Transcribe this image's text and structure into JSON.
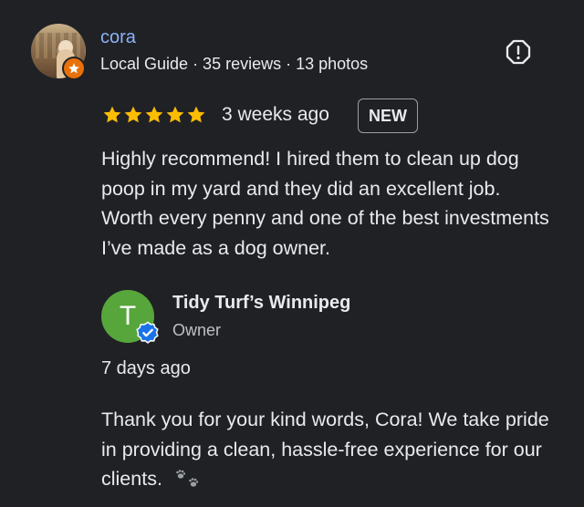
{
  "reviewer": {
    "name": "cora",
    "meta": "Local Guide · 35 reviews · 13 photos"
  },
  "review": {
    "rating": 5,
    "time": "3 weeks ago",
    "badge": "NEW",
    "text": "Highly recommend! I hired them to clean up dog poop in my yard and they did an excellent job. Worth every penny and one of the best investments I’ve made as a dog owner."
  },
  "owner": {
    "initial": "T",
    "name": "Tidy Turf’s Winnipeg",
    "role": "Owner",
    "time": "7 days ago",
    "reply": "Thank you for your kind words, Cora! We take pride in providing a clean, hassle-free experience for our clients."
  },
  "icons": {
    "star_color": "#fbbc04",
    "owner_avatar_color": "#57a63b",
    "verified_color": "#1a73e8",
    "guide_badge_color": "#e8710a",
    "report": "report-flag-icon",
    "paw": "paw-prints-icon"
  }
}
